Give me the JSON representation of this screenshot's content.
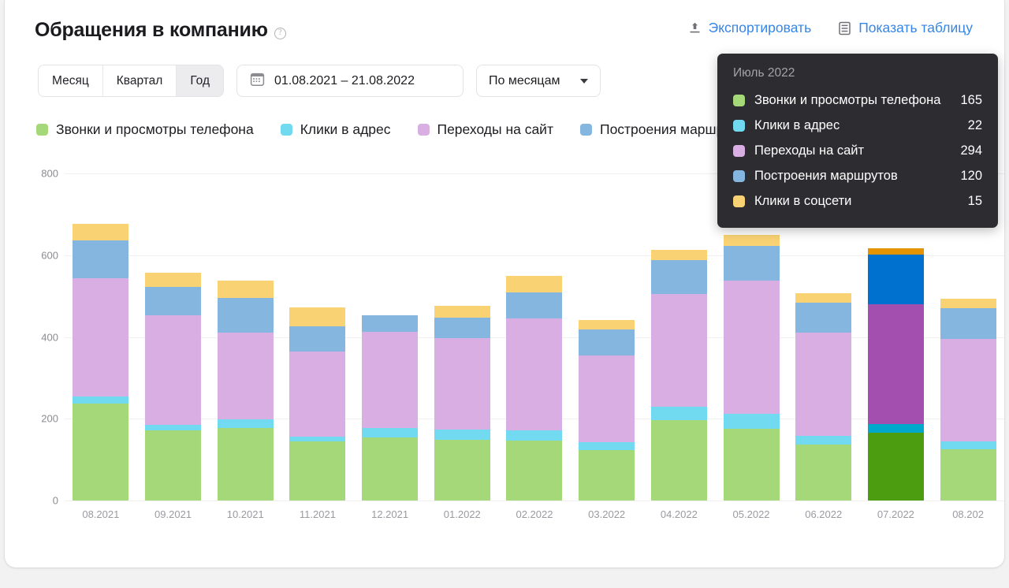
{
  "header": {
    "title": "Обращения в компанию",
    "help_icon": "question-circle-icon",
    "export_label": "Экспортировать",
    "export_icon": "upload-icon",
    "show_table_label": "Показать таблицу",
    "show_table_icon": "table-icon"
  },
  "toolbar": {
    "period_buttons": [
      {
        "label": "Месяц",
        "active": false
      },
      {
        "label": "Квартал",
        "active": false
      },
      {
        "label": "Год",
        "active": true
      }
    ],
    "date_range": {
      "icon": "calendar-icon",
      "value": "01.08.2021 – 21.08.2022"
    },
    "grouping": {
      "value": "По месяцам",
      "icon": "chevron-down-icon"
    }
  },
  "colors": {
    "accent_link": "#3586e8",
    "series_calls": "#A5D878",
    "series_address": "#71D9F0",
    "series_site": "#D9AEE3",
    "series_routes": "#85B6DF",
    "series_social": "#F8D273",
    "series_calls_hl": "#4C9E10",
    "series_address_hl": "#00A8CC",
    "series_site_hl": "#A24FB0",
    "series_routes_hl": "#0071CE",
    "series_social_hl": "#E59400",
    "tooltip_bg": "#2d2d31",
    "grid": "#f0f0f1"
  },
  "tooltip": {
    "title": "Июль 2022",
    "rows": [
      {
        "name": "Звонки и просмотры телефона",
        "value": "165",
        "color": "#A5D878"
      },
      {
        "name": "Клики в адрес",
        "value": "22",
        "color": "#71D9F0"
      },
      {
        "name": "Переходы на сайт",
        "value": "294",
        "color": "#D9AEE3"
      },
      {
        "name": "Построения маршрутов",
        "value": "120",
        "color": "#85B6DF"
      },
      {
        "name": "Клики в соцсети",
        "value": "15",
        "color": "#F8D273"
      }
    ]
  },
  "chart_data": {
    "type": "bar",
    "stacked": true,
    "title": "Обращения в компанию",
    "xlabel": "",
    "ylabel": "",
    "ylim": [
      0,
      800
    ],
    "yticks": [
      "0",
      "200",
      "400",
      "600",
      "800"
    ],
    "grid": true,
    "legend_position": "top",
    "highlight_category": "07.2022",
    "categories": [
      "08.2021",
      "09.2021",
      "10.2021",
      "11.2021",
      "12.2021",
      "01.2022",
      "02.2022",
      "03.2022",
      "04.2022",
      "05.2022",
      "06.2022",
      "07.2022",
      "08.202"
    ],
    "series": [
      {
        "name": "Звонки и просмотры телефона",
        "color": "#A5D878",
        "color_highlight": "#4C9E10",
        "values": [
          238,
          172,
          178,
          145,
          155,
          148,
          146,
          123,
          196,
          176,
          137,
          165,
          126
        ]
      },
      {
        "name": "Клики в адрес",
        "color": "#71D9F0",
        "color_highlight": "#00A8CC",
        "values": [
          17,
          14,
          20,
          12,
          22,
          25,
          26,
          19,
          33,
          37,
          22,
          22,
          19
        ]
      },
      {
        "name": "Переходы на сайт",
        "color": "#D9AEE3",
        "color_highlight": "#A24FB0",
        "values": [
          289,
          267,
          212,
          207,
          235,
          225,
          274,
          213,
          277,
          325,
          251,
          294,
          251
        ]
      },
      {
        "name": "Построения маршрутов",
        "color": "#85B6DF",
        "color_highlight": "#0071CE",
        "values": [
          92,
          70,
          86,
          63,
          41,
          50,
          63,
          63,
          82,
          84,
          73,
          120,
          74
        ]
      },
      {
        "name": "Клики в соцсети",
        "color": "#F8D273",
        "color_highlight": "#E59400",
        "values": [
          40,
          34,
          41,
          46,
          0,
          29,
          40,
          23,
          25,
          27,
          25,
          15,
          24
        ]
      }
    ]
  }
}
